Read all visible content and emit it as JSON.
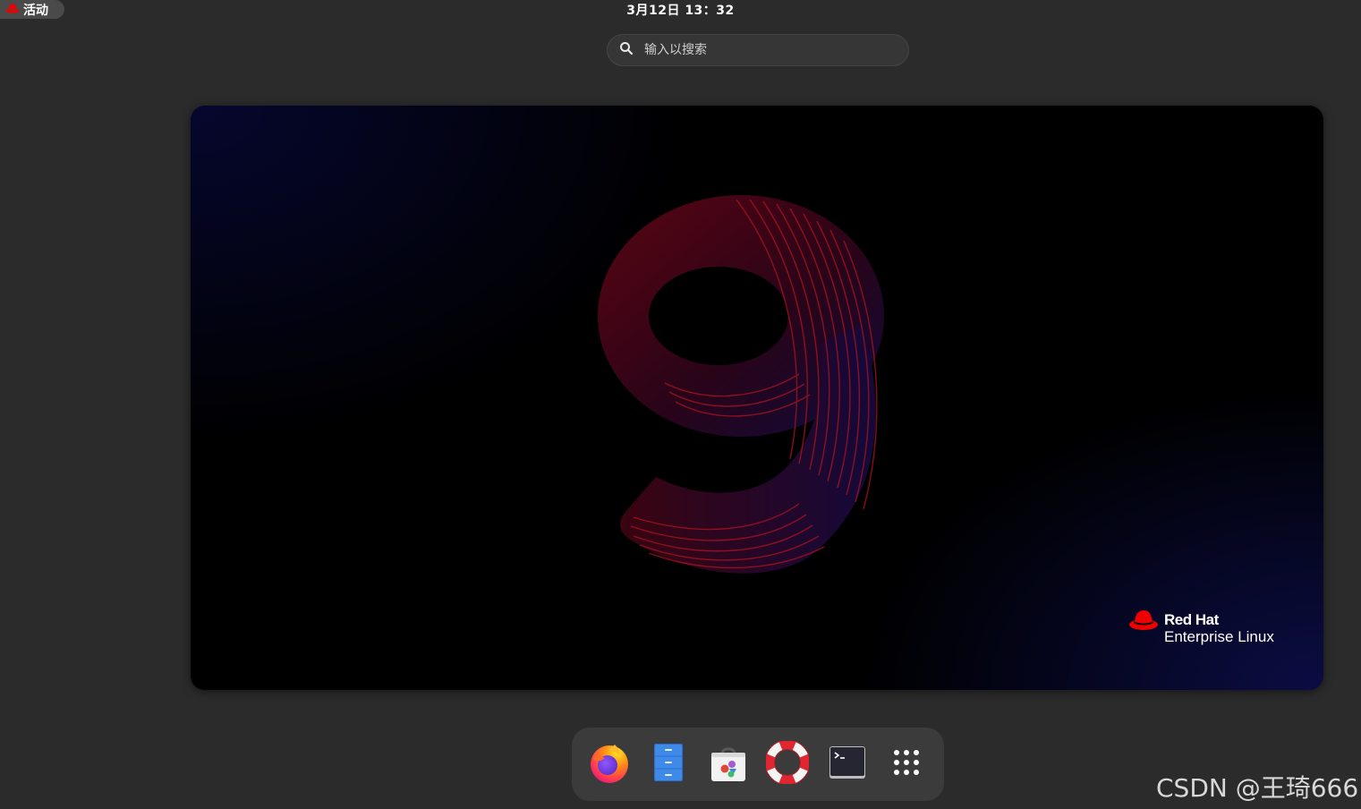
{
  "topbar": {
    "activities_label": "活动",
    "clock": "3月12日 13：32"
  },
  "search": {
    "placeholder": "输入以搜索"
  },
  "wallpaper": {
    "brand_line1": "Red Hat",
    "brand_line2": "Enterprise Linux",
    "brand_color": "#ee0000"
  },
  "dock": {
    "items": [
      {
        "name": "firefox",
        "icon": "firefox-icon"
      },
      {
        "name": "files",
        "icon": "files-icon"
      },
      {
        "name": "software",
        "icon": "software-icon"
      },
      {
        "name": "help",
        "icon": "help-icon"
      },
      {
        "name": "terminal",
        "icon": "terminal-icon"
      },
      {
        "name": "show-apps",
        "icon": "app-grid-icon"
      }
    ]
  },
  "watermark": "CSDN @王琦666"
}
